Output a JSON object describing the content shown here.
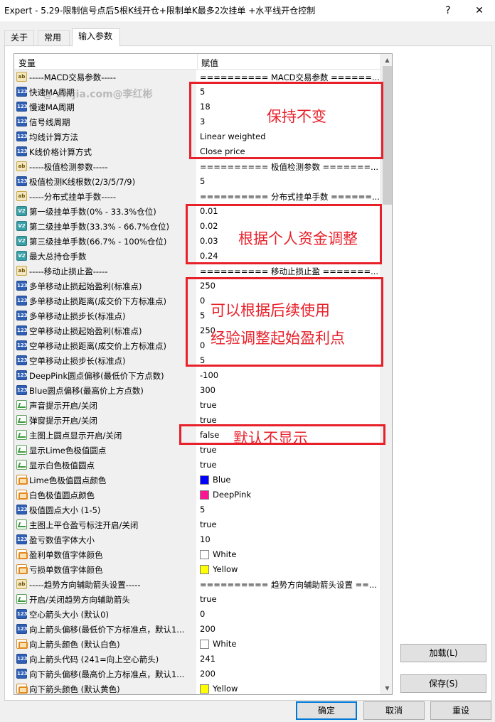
{
  "window": {
    "title": "Expert - 5.29-限制信号点后5根K线开仓+限制单K最多2次挂单 +水平线开仓控制",
    "help_label": "?",
    "close_label": "✕"
  },
  "tabs": [
    {
      "label": "关于"
    },
    {
      "label": "常用"
    },
    {
      "label": "输入参数"
    }
  ],
  "table": {
    "col_variable": "变量",
    "col_value": "赋值",
    "rows": [
      {
        "type": "ab",
        "name": "-----MACD交易参数-----",
        "value": "========== MACD交易参数 ======..."
      },
      {
        "type": "num",
        "name": "快速MA周期",
        "value": "5"
      },
      {
        "type": "num",
        "name": "慢速MA周期",
        "value": "18"
      },
      {
        "type": "num",
        "name": "信号线周期",
        "value": "3"
      },
      {
        "type": "num",
        "name": "均线计算方法",
        "value": "Linear weighted"
      },
      {
        "type": "num",
        "name": "K线价格计算方式",
        "value": "Close price"
      },
      {
        "type": "ab",
        "name": "-----极值检测参数-----",
        "value": "========== 极值检测参数 =======..."
      },
      {
        "type": "num",
        "name": "极值检测K线根数(2/3/5/7/9)",
        "value": "5"
      },
      {
        "type": "ab",
        "name": "-----分布式挂单手数-----",
        "value": "========== 分布式挂单手数 ======..."
      },
      {
        "type": "dbl",
        "name": "第一级挂单手数(0% - 33.3%仓位)",
        "value": "0.01"
      },
      {
        "type": "dbl",
        "name": "第二级挂单手数(33.3% - 66.7%仓位)",
        "value": "0.02"
      },
      {
        "type": "dbl",
        "name": "第三级挂单手数(66.7% - 100%仓位)",
        "value": "0.03"
      },
      {
        "type": "dbl",
        "name": "最大总持仓手数",
        "value": "0.24"
      },
      {
        "type": "ab",
        "name": "-----移动止损止盈-----",
        "value": "========== 移动止损止盈 =======..."
      },
      {
        "type": "num",
        "name": "多单移动止损起始盈利(标准点)",
        "value": "250"
      },
      {
        "type": "num",
        "name": "多单移动止损距离(成交价下方标准点)",
        "value": "0"
      },
      {
        "type": "num",
        "name": "多单移动止损步长(标准点)",
        "value": "5"
      },
      {
        "type": "num",
        "name": "空单移动止损起始盈利(标准点)",
        "value": "250"
      },
      {
        "type": "num",
        "name": "空单移动止损距离(成交价上方标准点)",
        "value": "0"
      },
      {
        "type": "num",
        "name": "空单移动止损步长(标准点)",
        "value": "5"
      },
      {
        "type": "num",
        "name": "DeepPink圆点偏移(最低价下方点数)",
        "value": "-100"
      },
      {
        "type": "num",
        "name": "Blue圆点偏移(最高价上方点数)",
        "value": "300"
      },
      {
        "type": "bool",
        "name": "声音提示开启/关闭",
        "value": "true"
      },
      {
        "type": "bool",
        "name": "弹窗提示开启/关闭",
        "value": "true"
      },
      {
        "type": "bool",
        "name": "主图上圆点显示开启/关闭",
        "value": "false"
      },
      {
        "type": "bool",
        "name": "显示Lime色极值圆点",
        "value": "true"
      },
      {
        "type": "bool",
        "name": "显示白色极值圆点",
        "value": "true"
      },
      {
        "type": "color",
        "name": "Lime色极值圆点颜色",
        "value": "Blue",
        "swatch": "#0000ff"
      },
      {
        "type": "color",
        "name": "白色极值圆点颜色",
        "value": "DeepPink",
        "swatch": "#ff1493"
      },
      {
        "type": "num",
        "name": "极值圆点大小 (1-5)",
        "value": "5"
      },
      {
        "type": "bool",
        "name": "主图上平仓盈亏标注开启/关闭",
        "value": "true"
      },
      {
        "type": "num",
        "name": "盈亏数值字体大小",
        "value": "10"
      },
      {
        "type": "color",
        "name": "盈利单数值字体颜色",
        "value": "White",
        "swatch": "#ffffff"
      },
      {
        "type": "color",
        "name": "亏损单数值字体颜色",
        "value": "Yellow",
        "swatch": "#ffff00"
      },
      {
        "type": "ab",
        "name": "-----趋势方向辅助箭头设置-----",
        "value": "========== 趋势方向辅助箭头设置 ==..."
      },
      {
        "type": "bool",
        "name": "开启/关闭趋势方向辅助箭头",
        "value": "true"
      },
      {
        "type": "num",
        "name": "空心箭头大小 (默认0)",
        "value": "0"
      },
      {
        "type": "num",
        "name": "向上箭头偏移(最低价下方标准点，默认1...",
        "value": "200"
      },
      {
        "type": "color",
        "name": "向上箭头颜色 (默认白色)",
        "value": "White",
        "swatch": "#ffffff"
      },
      {
        "type": "num",
        "name": "向上箭头代码 (241=向上空心箭头)",
        "value": "241"
      },
      {
        "type": "num",
        "name": "向下箭头偏移(最高价上方标准点，默认1...",
        "value": "200"
      },
      {
        "type": "color",
        "name": "向下箭头颜色 (默认黄色)",
        "value": "Yellow",
        "swatch": "#ffff00"
      }
    ]
  },
  "annotations": {
    "keep": "保持不变",
    "adjust_funds": "根据个人资金调整",
    "adjust_profit_line1": "可以根据后续使用",
    "adjust_profit_line2": "经验调整起始盈利点",
    "default_hidden": "默认不显示",
    "color": "#e8202a"
  },
  "watermark": "@ zhijia.com@李红彬",
  "buttons": {
    "load": "加载(L)",
    "save": "保存(S)",
    "ok": "确定",
    "cancel": "取消",
    "reset": "重设"
  }
}
